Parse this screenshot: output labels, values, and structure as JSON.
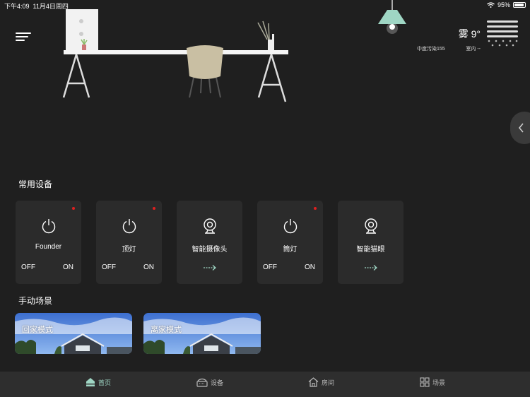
{
  "status_bar": {
    "time": "下午4:09",
    "date": "11月4日周四",
    "battery": "95%",
    "battery_level": 0.95
  },
  "menu": {
    "icon": "hamburger-menu-icon"
  },
  "weather": {
    "temp": "雾 9°",
    "pollution": "中度污染155",
    "indoor": "室内 --",
    "icon": "fog-icon"
  },
  "sections": {
    "devices_title": "常用设备",
    "scenes_title": "手动场景"
  },
  "devices": [
    {
      "name": "Founder",
      "type": "switch",
      "off": "OFF",
      "on": "ON",
      "alert": true,
      "icon": "power-icon"
    },
    {
      "name": "顶灯",
      "type": "switch",
      "off": "OFF",
      "on": "ON",
      "alert": true,
      "icon": "power-icon"
    },
    {
      "name": "智能摄像头",
      "type": "link",
      "alert": false,
      "icon": "camera-icon"
    },
    {
      "name": "筒灯",
      "type": "switch",
      "off": "OFF",
      "on": "ON",
      "alert": true,
      "icon": "power-icon"
    },
    {
      "name": "智能猫眼",
      "type": "link",
      "alert": false,
      "icon": "camera-icon"
    }
  ],
  "scenes": [
    {
      "label": "回家模式"
    },
    {
      "label": "离家模式"
    }
  ],
  "tabs": [
    {
      "label": "首页",
      "icon": "home-icon",
      "active": true
    },
    {
      "label": "设备",
      "icon": "device-icon",
      "active": false
    },
    {
      "label": "房间",
      "icon": "room-icon",
      "active": false
    },
    {
      "label": "场景",
      "icon": "grid-icon",
      "active": false
    }
  ],
  "colors": {
    "background": "#1f1f1f",
    "card": "#2b2b2b",
    "accent": "#9fd6c4",
    "alert": "#e02020"
  }
}
